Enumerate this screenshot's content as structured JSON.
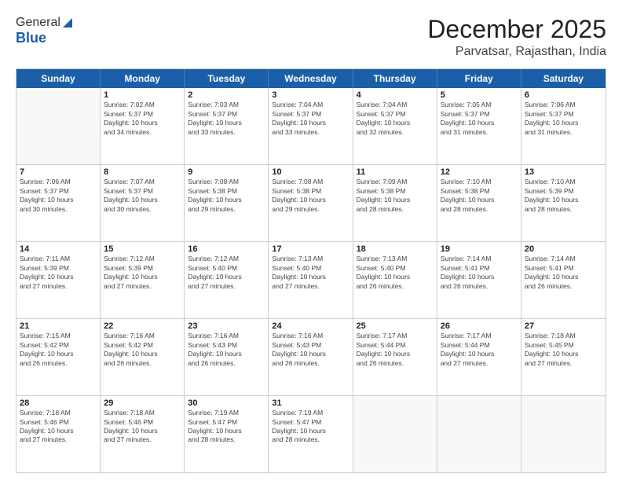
{
  "header": {
    "logo_general": "General",
    "logo_blue": "Blue",
    "main_title": "December 2025",
    "sub_title": "Parvatsar, Rajasthan, India"
  },
  "calendar": {
    "days_of_week": [
      "Sunday",
      "Monday",
      "Tuesday",
      "Wednesday",
      "Thursday",
      "Friday",
      "Saturday"
    ],
    "rows": [
      [
        {
          "day": "",
          "lines": []
        },
        {
          "day": "1",
          "lines": [
            "Sunrise: 7:02 AM",
            "Sunset: 5:37 PM",
            "Daylight: 10 hours",
            "and 34 minutes."
          ]
        },
        {
          "day": "2",
          "lines": [
            "Sunrise: 7:03 AM",
            "Sunset: 5:37 PM",
            "Daylight: 10 hours",
            "and 33 minutes."
          ]
        },
        {
          "day": "3",
          "lines": [
            "Sunrise: 7:04 AM",
            "Sunset: 5:37 PM",
            "Daylight: 10 hours",
            "and 33 minutes."
          ]
        },
        {
          "day": "4",
          "lines": [
            "Sunrise: 7:04 AM",
            "Sunset: 5:37 PM",
            "Daylight: 10 hours",
            "and 32 minutes."
          ]
        },
        {
          "day": "5",
          "lines": [
            "Sunrise: 7:05 AM",
            "Sunset: 5:37 PM",
            "Daylight: 10 hours",
            "and 31 minutes."
          ]
        },
        {
          "day": "6",
          "lines": [
            "Sunrise: 7:06 AM",
            "Sunset: 5:37 PM",
            "Daylight: 10 hours",
            "and 31 minutes."
          ]
        }
      ],
      [
        {
          "day": "7",
          "lines": [
            "Sunrise: 7:06 AM",
            "Sunset: 5:37 PM",
            "Daylight: 10 hours",
            "and 30 minutes."
          ]
        },
        {
          "day": "8",
          "lines": [
            "Sunrise: 7:07 AM",
            "Sunset: 5:37 PM",
            "Daylight: 10 hours",
            "and 30 minutes."
          ]
        },
        {
          "day": "9",
          "lines": [
            "Sunrise: 7:08 AM",
            "Sunset: 5:38 PM",
            "Daylight: 10 hours",
            "and 29 minutes."
          ]
        },
        {
          "day": "10",
          "lines": [
            "Sunrise: 7:08 AM",
            "Sunset: 5:38 PM",
            "Daylight: 10 hours",
            "and 29 minutes."
          ]
        },
        {
          "day": "11",
          "lines": [
            "Sunrise: 7:09 AM",
            "Sunset: 5:38 PM",
            "Daylight: 10 hours",
            "and 28 minutes."
          ]
        },
        {
          "day": "12",
          "lines": [
            "Sunrise: 7:10 AM",
            "Sunset: 5:38 PM",
            "Daylight: 10 hours",
            "and 28 minutes."
          ]
        },
        {
          "day": "13",
          "lines": [
            "Sunrise: 7:10 AM",
            "Sunset: 5:39 PM",
            "Daylight: 10 hours",
            "and 28 minutes."
          ]
        }
      ],
      [
        {
          "day": "14",
          "lines": [
            "Sunrise: 7:11 AM",
            "Sunset: 5:39 PM",
            "Daylight: 10 hours",
            "and 27 minutes."
          ]
        },
        {
          "day": "15",
          "lines": [
            "Sunrise: 7:12 AM",
            "Sunset: 5:39 PM",
            "Daylight: 10 hours",
            "and 27 minutes."
          ]
        },
        {
          "day": "16",
          "lines": [
            "Sunrise: 7:12 AM",
            "Sunset: 5:40 PM",
            "Daylight: 10 hours",
            "and 27 minutes."
          ]
        },
        {
          "day": "17",
          "lines": [
            "Sunrise: 7:13 AM",
            "Sunset: 5:40 PM",
            "Daylight: 10 hours",
            "and 27 minutes."
          ]
        },
        {
          "day": "18",
          "lines": [
            "Sunrise: 7:13 AM",
            "Sunset: 5:40 PM",
            "Daylight: 10 hours",
            "and 26 minutes."
          ]
        },
        {
          "day": "19",
          "lines": [
            "Sunrise: 7:14 AM",
            "Sunset: 5:41 PM",
            "Daylight: 10 hours",
            "and 26 minutes."
          ]
        },
        {
          "day": "20",
          "lines": [
            "Sunrise: 7:14 AM",
            "Sunset: 5:41 PM",
            "Daylight: 10 hours",
            "and 26 minutes."
          ]
        }
      ],
      [
        {
          "day": "21",
          "lines": [
            "Sunrise: 7:15 AM",
            "Sunset: 5:42 PM",
            "Daylight: 10 hours",
            "and 26 minutes."
          ]
        },
        {
          "day": "22",
          "lines": [
            "Sunrise: 7:16 AM",
            "Sunset: 5:42 PM",
            "Daylight: 10 hours",
            "and 26 minutes."
          ]
        },
        {
          "day": "23",
          "lines": [
            "Sunrise: 7:16 AM",
            "Sunset: 5:43 PM",
            "Daylight: 10 hours",
            "and 26 minutes."
          ]
        },
        {
          "day": "24",
          "lines": [
            "Sunrise: 7:16 AM",
            "Sunset: 5:43 PM",
            "Daylight: 10 hours",
            "and 26 minutes."
          ]
        },
        {
          "day": "25",
          "lines": [
            "Sunrise: 7:17 AM",
            "Sunset: 5:44 PM",
            "Daylight: 10 hours",
            "and 26 minutes."
          ]
        },
        {
          "day": "26",
          "lines": [
            "Sunrise: 7:17 AM",
            "Sunset: 5:44 PM",
            "Daylight: 10 hours",
            "and 27 minutes."
          ]
        },
        {
          "day": "27",
          "lines": [
            "Sunrise: 7:18 AM",
            "Sunset: 5:45 PM",
            "Daylight: 10 hours",
            "and 27 minutes."
          ]
        }
      ],
      [
        {
          "day": "28",
          "lines": [
            "Sunrise: 7:18 AM",
            "Sunset: 5:46 PM",
            "Daylight: 10 hours",
            "and 27 minutes."
          ]
        },
        {
          "day": "29",
          "lines": [
            "Sunrise: 7:18 AM",
            "Sunset: 5:46 PM",
            "Daylight: 10 hours",
            "and 27 minutes."
          ]
        },
        {
          "day": "30",
          "lines": [
            "Sunrise: 7:19 AM",
            "Sunset: 5:47 PM",
            "Daylight: 10 hours",
            "and 28 minutes."
          ]
        },
        {
          "day": "31",
          "lines": [
            "Sunrise: 7:19 AM",
            "Sunset: 5:47 PM",
            "Daylight: 10 hours",
            "and 28 minutes."
          ]
        },
        {
          "day": "",
          "lines": []
        },
        {
          "day": "",
          "lines": []
        },
        {
          "day": "",
          "lines": []
        }
      ]
    ]
  }
}
